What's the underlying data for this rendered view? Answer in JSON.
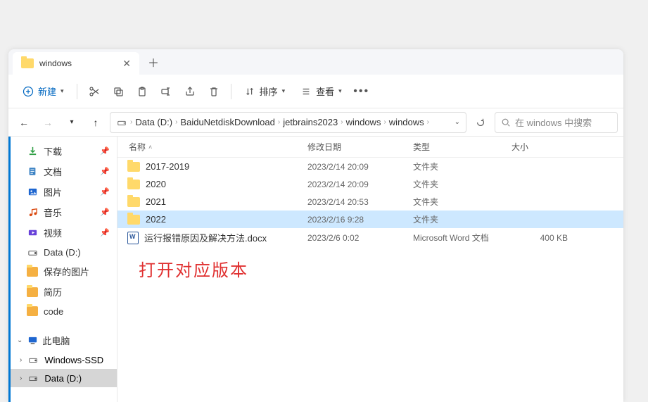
{
  "tab": {
    "title": "windows"
  },
  "toolbar": {
    "new_label": "新建",
    "sort_label": "排序",
    "view_label": "查看"
  },
  "breadcrumb": {
    "items": [
      "Data (D:)",
      "BaiduNetdiskDownload",
      "jetbrains2023",
      "windows",
      "windows"
    ]
  },
  "search": {
    "placeholder": "在 windows 中搜索"
  },
  "columns": {
    "name": "名称",
    "date": "修改日期",
    "type": "类型",
    "size": "大小"
  },
  "sidebar": {
    "quick": [
      {
        "label": "下载",
        "icon": "download",
        "color": "#2f9e44"
      },
      {
        "label": "文档",
        "icon": "document",
        "color": "#3b82c4"
      },
      {
        "label": "图片",
        "icon": "picture",
        "color": "#1e66d0"
      },
      {
        "label": "音乐",
        "icon": "music",
        "color": "#d9480f"
      },
      {
        "label": "视频",
        "icon": "video",
        "color": "#6741d9"
      },
      {
        "label": "Data (D:)",
        "icon": "drive",
        "color": "#555"
      },
      {
        "label": "保存的图片",
        "icon": "folder",
        "color": "#f5b042"
      },
      {
        "label": "简历",
        "icon": "folder",
        "color": "#f5b042"
      },
      {
        "label": "code",
        "icon": "folder",
        "color": "#f5b042"
      }
    ],
    "thispc": "此电脑",
    "drives": [
      {
        "label": "Windows-SSD",
        "icon": "drive"
      },
      {
        "label": "Data (D:)",
        "icon": "drive"
      }
    ]
  },
  "files": [
    {
      "name": "2017-2019",
      "date": "2023/2/14 20:09",
      "type": "文件夹",
      "size": "",
      "icon": "folder",
      "selected": false
    },
    {
      "name": "2020",
      "date": "2023/2/14 20:09",
      "type": "文件夹",
      "size": "",
      "icon": "folder",
      "selected": false
    },
    {
      "name": "2021",
      "date": "2023/2/14 20:53",
      "type": "文件夹",
      "size": "",
      "icon": "folder",
      "selected": false
    },
    {
      "name": "2022",
      "date": "2023/2/16 9:28",
      "type": "文件夹",
      "size": "",
      "icon": "folder",
      "selected": true
    },
    {
      "name": "运行报错原因及解决方法.docx",
      "date": "2023/2/6 0:02",
      "type": "Microsoft Word 文档",
      "size": "400 KB",
      "icon": "docx",
      "selected": false
    }
  ],
  "annotation": "打开对应版本"
}
